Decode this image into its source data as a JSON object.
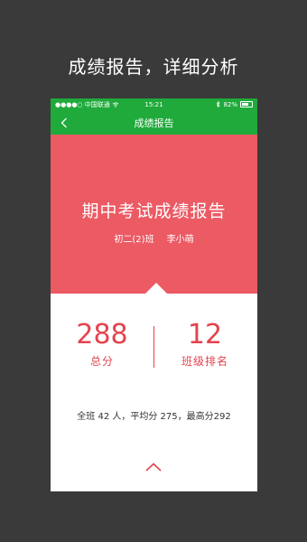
{
  "caption": "成绩报告，详细分析",
  "statusbar": {
    "carrier": "●●●●○ 中国联通",
    "time": "15:21",
    "battery": "82%"
  },
  "navbar": {
    "title": "成绩报告"
  },
  "hero": {
    "title": "期中考试成绩报告",
    "class_name": "初二(2)班",
    "student": "李小萌"
  },
  "stats": {
    "total_score": "288",
    "total_label": "总分",
    "rank": "12",
    "rank_label": "班级排名"
  },
  "summary": "全班 42 人，平均分 275，最高分292",
  "colors": {
    "background": "#3a3a3a",
    "brand_green": "#1faa3b",
    "hero_red": "#ec5a64",
    "accent_red": "#e4434f"
  },
  "icons": {
    "back": "chevron-left-icon",
    "expand": "chevron-up-icon",
    "wifi": "wifi-icon",
    "bluetooth": "bluetooth-icon",
    "battery": "battery-icon"
  }
}
